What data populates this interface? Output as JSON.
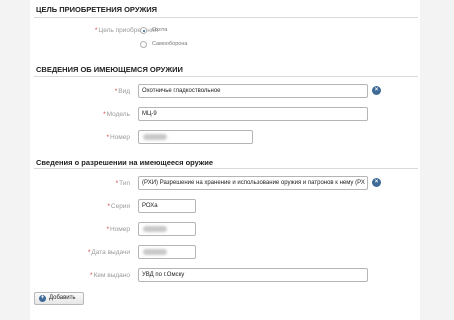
{
  "purpose": {
    "title": "ЦЕЛЬ ПРИОБРЕТЕНИЯ ОРУЖИЯ",
    "field_label": "Цель приобретения",
    "options": [
      "Охота",
      "Самооборона"
    ],
    "selected": "Охота"
  },
  "existing": {
    "title": "СВЕДЕНИЯ ОБ ИМЕЮЩЕМСЯ ОРУЖИИ",
    "type_label": "Вид",
    "type_value": "Охотничье гладкоствольное",
    "model_label": "Модель",
    "model_value": "МЦ-9",
    "number_label": "Номер"
  },
  "permit": {
    "title": "Сведения о разрешении на имеющееся оружие",
    "type_label": "Тип",
    "type_value": "(РХИ) Разрешение на хранение и использование оружия и патронов к нему (РХ",
    "series_label": "Серия",
    "series_value": "РОХа",
    "number_label": "Номер",
    "date_label": "Дата выдачи",
    "issuer_label": "Кем выдано",
    "issuer_value": "УВД по г.Омску"
  },
  "add_button_label": "Добавить",
  "required_mark": "*",
  "icons": {
    "clear": "close-icon",
    "add": "plus-icon"
  }
}
